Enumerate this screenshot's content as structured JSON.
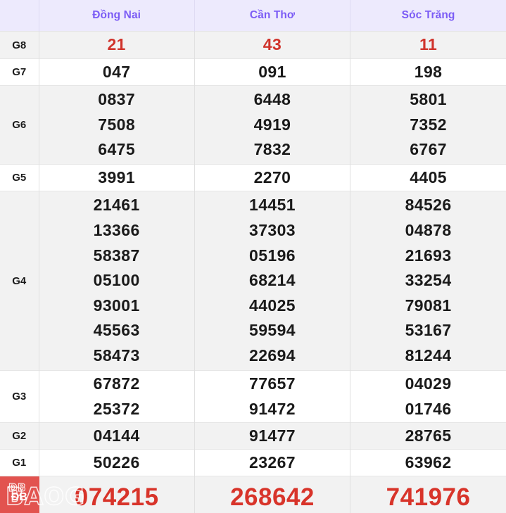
{
  "table": {
    "label_column_header": "",
    "provinces": [
      "Đồng Nai",
      "Cần Thơ",
      "Sóc Trăng"
    ],
    "colors": {
      "header_bg": "#edeafd",
      "header_text": "#7b5cf5",
      "shade_row_bg": "#f2f2f2",
      "plain_row_bg": "#ffffff",
      "number_text": "#1a1a1a",
      "g8_red": "#d0342c",
      "db_label_bg": "#e2534f",
      "db_number_red": "#d8342a",
      "grid_line": "#e0e0e0"
    },
    "rows": [
      {
        "label": "G8",
        "values": [
          [
            "21"
          ],
          [
            "43"
          ],
          [
            "11"
          ]
        ]
      },
      {
        "label": "G7",
        "values": [
          [
            "047"
          ],
          [
            "091"
          ],
          [
            "198"
          ]
        ]
      },
      {
        "label": "G6",
        "values": [
          [
            "0837",
            "7508",
            "6475"
          ],
          [
            "6448",
            "4919",
            "7832"
          ],
          [
            "5801",
            "7352",
            "6767"
          ]
        ]
      },
      {
        "label": "G5",
        "values": [
          [
            "3991"
          ],
          [
            "2270"
          ],
          [
            "4405"
          ]
        ]
      },
      {
        "label": "G4",
        "values": [
          [
            "21461",
            "13366",
            "58387",
            "05100",
            "93001",
            "45563",
            "58473"
          ],
          [
            "14451",
            "37303",
            "05196",
            "68214",
            "44025",
            "59594",
            "22694"
          ],
          [
            "84526",
            "04878",
            "21693",
            "33254",
            "79081",
            "53167",
            "81244"
          ]
        ]
      },
      {
        "label": "G3",
        "values": [
          [
            "67872",
            "25372"
          ],
          [
            "77657",
            "91472"
          ],
          [
            "04029",
            "01746"
          ]
        ]
      },
      {
        "label": "G2",
        "values": [
          [
            "04144"
          ],
          [
            "91477"
          ],
          [
            "28765"
          ]
        ]
      },
      {
        "label": "G1",
        "values": [
          [
            "50226"
          ],
          [
            "23267"
          ],
          [
            "63962"
          ]
        ]
      },
      {
        "label": "ĐB",
        "values": [
          [
            "074215"
          ],
          [
            "268642"
          ],
          [
            "741976"
          ]
        ]
      }
    ]
  },
  "watermark": {
    "line1": "ĐB",
    "line2": "BAOG"
  }
}
